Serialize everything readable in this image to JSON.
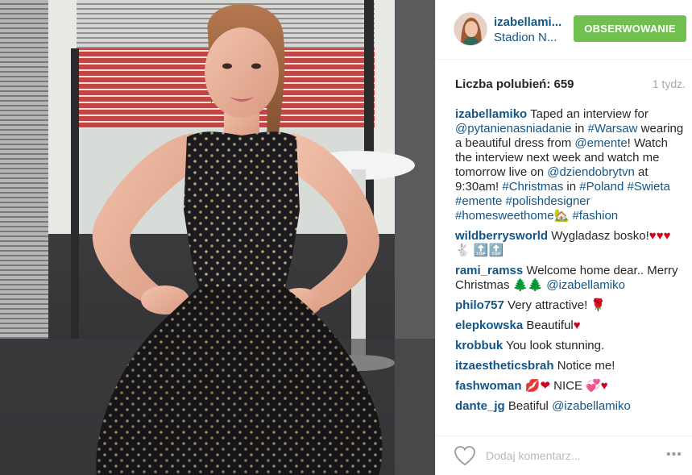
{
  "post": {
    "owner_name": "izabellami...",
    "owner_location": "Stadion N...",
    "follow_label": "OBSERWOWANIE",
    "likes_label": "Liczba polubień: 659",
    "time_ago": "1 tydz.",
    "caption": {
      "user": "izabellamiko",
      "text_1": " Taped an interview for ",
      "tag_1": "@pytanienasniadanie",
      "text_2": " in ",
      "tag_2": "#Warsaw",
      "text_3": " wearing a beautiful dress from ",
      "tag_3": "@emente",
      "text_4": "! Watch the interview next week and watch me tomorrow live on ",
      "tag_4": "@dziendobrytvn",
      "text_5": " at 9:30am! ",
      "tag_5": "#Christmas",
      "text_6": " in ",
      "tag_6": "#Poland",
      "text_7": " ",
      "tag_7": "#Swieta",
      "text_8": " ",
      "tag_8": "#emente",
      "text_9": " ",
      "tag_9": "#polishdesigner",
      "text_10": " ",
      "tag_10": "#homesweethome",
      "emoji_1": "🏡",
      "text_11": " ",
      "tag_11": "#fashion"
    },
    "comments": [
      {
        "user": "wildberrysworld",
        "text": " Wygladasz bosko!",
        "hearts": "♥♥♥",
        "extra": " 🐇 🔝🔝"
      },
      {
        "user": "rami_ramss",
        "text": " Welcome home dear.. Merry Christmas ",
        "trees": "🌲🌲",
        "mention": " @izabellamiko"
      },
      {
        "user": "philo757",
        "text": " Very attractive! ",
        "emoji": "🌹"
      },
      {
        "user": "elepkowska",
        "text": " Beautiful",
        "emoji": "♥"
      },
      {
        "user": "krobbuk",
        "text": " You look stunning."
      },
      {
        "user": "itzaestheticsbrah",
        "text": " Notice me!"
      },
      {
        "user": "fashwoman",
        "emoji_a": " 💋❤",
        "text": " NICE ",
        "emoji_b": "💞♥"
      },
      {
        "user": "dante_jg",
        "text": " Beatiful ",
        "mention": "@izabellamiko"
      }
    ],
    "comment_placeholder": "Dodaj komentarz...",
    "more_icon": "•••"
  },
  "colors": {
    "link_blue": "#125688",
    "follow_green": "#70c050",
    "muted_grey": "#a5a7aa"
  },
  "icons": {
    "like": "heart-outline-icon",
    "more": "ellipsis-icon"
  }
}
